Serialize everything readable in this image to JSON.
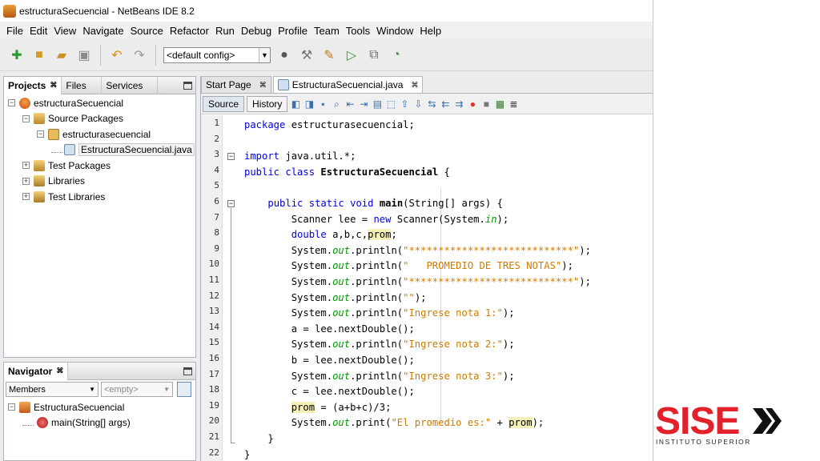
{
  "window": {
    "title": "estructuraSecuencial - NetBeans IDE 8.2"
  },
  "menu": [
    "File",
    "Edit",
    "View",
    "Navigate",
    "Source",
    "Refactor",
    "Run",
    "Debug",
    "Profile",
    "Team",
    "Tools",
    "Window",
    "Help"
  ],
  "toolbar": {
    "config_value": "<default config>"
  },
  "projects_panel": {
    "tabs": [
      "Projects",
      "Files",
      "Services"
    ],
    "tree": [
      {
        "label": "estructuraSecuencial",
        "indent": 0,
        "icon": "project-cup-icon",
        "expanded": true
      },
      {
        "label": "Source Packages",
        "indent": 1,
        "icon": "source-packages-icon",
        "expanded": true
      },
      {
        "label": "estructurasecuencial",
        "indent": 2,
        "icon": "package-icon",
        "expanded": true
      },
      {
        "label": "EstructuraSecuencial.java",
        "indent": 3,
        "icon": "java-file-icon",
        "selected": true
      },
      {
        "label": "Test Packages",
        "indent": 1,
        "icon": "test-packages-icon",
        "expanded": false
      },
      {
        "label": "Libraries",
        "indent": 1,
        "icon": "libraries-icon",
        "expanded": false
      },
      {
        "label": "Test Libraries",
        "indent": 1,
        "icon": "test-libraries-icon",
        "expanded": false
      }
    ]
  },
  "navigator": {
    "title": "Navigator",
    "members_value": "Members",
    "filter_value": "<empty>",
    "tree": [
      {
        "label": "EstructuraSecuencial",
        "indent": 0
      },
      {
        "label": "main(String[] args)",
        "indent": 1
      }
    ]
  },
  "editor": {
    "tabs": [
      "Start Page",
      "EstructuraSecuencial.java"
    ],
    "source_label": "Source",
    "history_label": "History",
    "lines": [
      "package estructurasecuencial;",
      "",
      "import java.util.*;",
      "public class EstructuraSecuencial {",
      "",
      "    public static void main(String[] args) {",
      "        Scanner lee = new Scanner(System.in);",
      "        double a,b,c,prom;",
      "        System.out.println(\"****************************\");",
      "        System.out.println(\"   PROMEDIO DE TRES NOTAS\");",
      "        System.out.println(\"****************************\");",
      "        System.out.println(\"\");",
      "        System.out.println(\"Ingrese nota 1:\");",
      "        a = lee.nextDouble();",
      "        System.out.println(\"Ingrese nota 2:\");",
      "        b = lee.nextDouble();",
      "        System.out.println(\"Ingrese nota 3:\");",
      "        c = lee.nextDouble();",
      "        prom = (a+b+c)/3;",
      "        System.out.print(\"El promedio es:\" + prom);",
      "    }",
      "}"
    ]
  },
  "logo": {
    "text": "SISE",
    "subtitle": "INSTITUTO SUPERIOR",
    "color": "#E3212B"
  }
}
